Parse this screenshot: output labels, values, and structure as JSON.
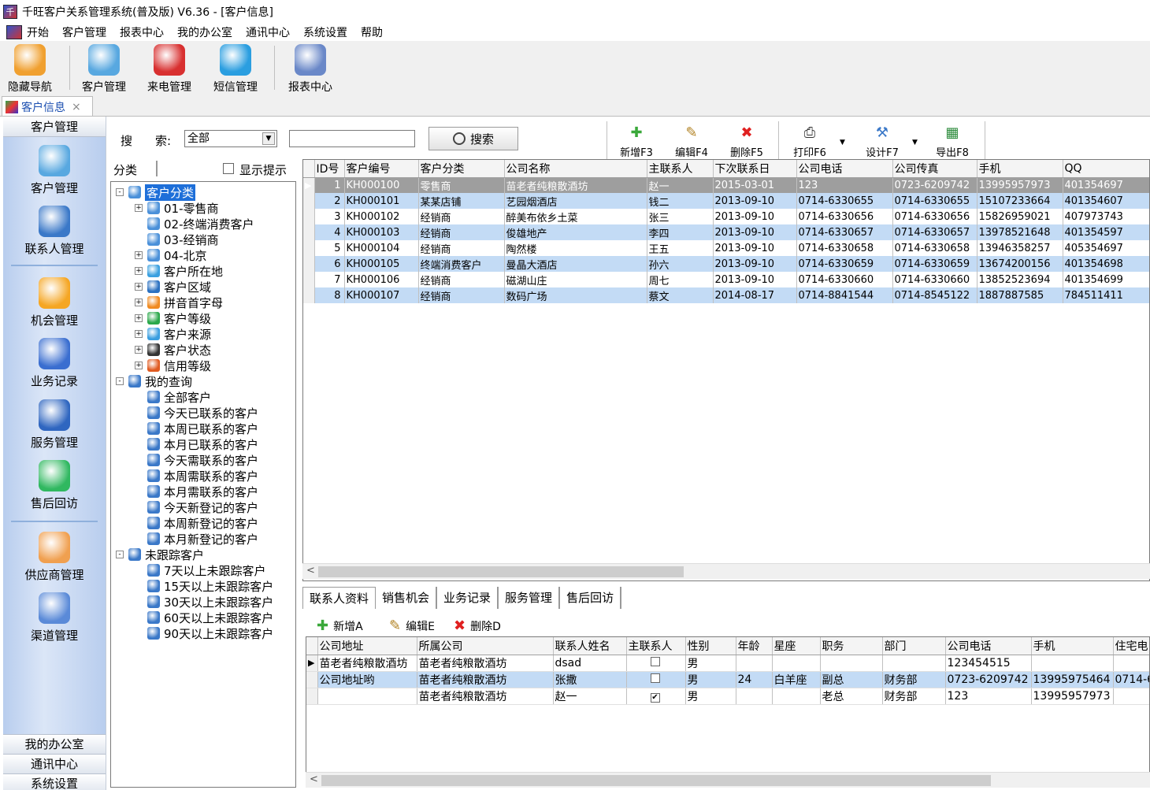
{
  "window": {
    "title": "千旺客户关系管理系统(普及版) V6.36 - [客户信息]"
  },
  "menu": [
    "开始",
    "客户管理",
    "报表中心",
    "我的办公室",
    "通讯中心",
    "系统设置",
    "帮助"
  ],
  "toolbar": {
    "items": [
      {
        "label": "隐藏导航",
        "icon": "butterfly-logo-icon",
        "color": "#f0a030"
      },
      {
        "label": "客户管理",
        "icon": "users-icon",
        "color": "#58a8e0"
      },
      {
        "label": "来电管理",
        "icon": "phone-icon",
        "color": "#d83030"
      },
      {
        "label": "短信管理",
        "icon": "message-icon",
        "color": "#2a9ee0"
      },
      {
        "label": "报表中心",
        "icon": "report-chart-icon",
        "color": "#6a88c8"
      }
    ]
  },
  "doc_tab": {
    "label": "客户信息",
    "close": "×"
  },
  "leftnav": {
    "header": "客户管理",
    "items": [
      {
        "label": "客户管理",
        "icon": "users-icon",
        "color": "#58a8e0"
      },
      {
        "label": "联系人管理",
        "icon": "contact-person-icon",
        "color": "#3a78c8"
      },
      {
        "label": "机会管理",
        "icon": "star-icon",
        "color": "#f5a623"
      },
      {
        "label": "业务记录",
        "icon": "business-chart-icon",
        "color": "#3a6ed0"
      },
      {
        "label": "服务管理",
        "icon": "globe-service-icon",
        "color": "#2f66c0"
      },
      {
        "label": "售后回访",
        "icon": "chat-bubble-icon",
        "color": "#30b860"
      },
      {
        "label": "供应商管理",
        "icon": "supplier-face-icon",
        "color": "#f0a050"
      },
      {
        "label": "渠道管理",
        "icon": "channel-plane-icon",
        "color": "#5a8ad8"
      }
    ],
    "footer": [
      "我的办公室",
      "通讯中心",
      "系统设置"
    ]
  },
  "search": {
    "label_1": "搜",
    "label_2": "索:",
    "field_value": "全部",
    "input_value": "",
    "button": "搜索"
  },
  "actions": [
    {
      "label": "新增F3",
      "icon": "plus-icon",
      "glyph": "✚",
      "color": "#3aa83a"
    },
    {
      "label": "编辑F4",
      "icon": "edit-icon",
      "glyph": "✎",
      "color": "#b08020"
    },
    {
      "label": "删除F5",
      "icon": "delete-icon",
      "glyph": "✖",
      "color": "#e02020"
    },
    {
      "label": "打印F6",
      "icon": "printer-icon",
      "glyph": "⎙",
      "color": "#333333"
    },
    {
      "label": "设计F7",
      "icon": "tools-icon",
      "glyph": "⚒",
      "color": "#3a78c8"
    },
    {
      "label": "导出F8",
      "icon": "excel-export-icon",
      "glyph": "▦",
      "color": "#2a8a3a"
    }
  ],
  "category": {
    "header": "分类",
    "show_tips": "显示提示",
    "tree": [
      {
        "label": "客户分类",
        "level": 0,
        "pm": "-",
        "icon": "folder-icon",
        "color": "#4a90d9",
        "selected": true
      },
      {
        "label": "01-零售商",
        "level": 1,
        "pm": "+",
        "icon": "folder-icon",
        "color": "#4a90d9"
      },
      {
        "label": "02-终端消费客户",
        "level": 1,
        "pm": "",
        "icon": "folder-icon",
        "color": "#4a90d9"
      },
      {
        "label": "03-经销商",
        "level": 1,
        "pm": "",
        "icon": "folder-icon",
        "color": "#4a90d9"
      },
      {
        "label": "04-北京",
        "level": 1,
        "pm": "+",
        "icon": "folder-icon",
        "color": "#4a90d9"
      },
      {
        "label": "客户所在地",
        "level": 1,
        "pm": "+",
        "icon": "globe-icon",
        "color": "#3aa0e0"
      },
      {
        "label": "客户区域",
        "level": 1,
        "pm": "+",
        "icon": "globe-icon",
        "color": "#2a70c0"
      },
      {
        "label": "拼音首字母",
        "level": 1,
        "pm": "+",
        "icon": "letter-a-icon",
        "color": "#f08a20"
      },
      {
        "label": "客户等级",
        "level": 1,
        "pm": "+",
        "icon": "share-icon",
        "color": "#2aa84a"
      },
      {
        "label": "客户来源",
        "level": 1,
        "pm": "+",
        "icon": "source-icon",
        "color": "#3a9ee0"
      },
      {
        "label": "客户状态",
        "level": 1,
        "pm": "+",
        "icon": "status-icon",
        "color": "#333333"
      },
      {
        "label": "信用等级",
        "level": 1,
        "pm": "+",
        "icon": "credit-icon",
        "color": "#e05a20"
      },
      {
        "label": "我的查询",
        "level": 0,
        "pm": "-",
        "icon": "query-phone-icon",
        "color": "#3a78c8"
      },
      {
        "label": "全部客户",
        "level": 1,
        "pm": "",
        "icon": "query-phone-icon",
        "color": "#3a78c8"
      },
      {
        "label": "今天已联系的客户",
        "level": 1,
        "pm": "",
        "icon": "query-phone-icon",
        "color": "#3a78c8"
      },
      {
        "label": "本周已联系的客户",
        "level": 1,
        "pm": "",
        "icon": "query-phone-icon",
        "color": "#3a78c8"
      },
      {
        "label": "本月已联系的客户",
        "level": 1,
        "pm": "",
        "icon": "query-phone-icon",
        "color": "#3a78c8"
      },
      {
        "label": "今天需联系的客户",
        "level": 1,
        "pm": "",
        "icon": "query-phone-icon",
        "color": "#3a78c8"
      },
      {
        "label": "本周需联系的客户",
        "level": 1,
        "pm": "",
        "icon": "query-phone-icon",
        "color": "#3a78c8"
      },
      {
        "label": "本月需联系的客户",
        "level": 1,
        "pm": "",
        "icon": "query-phone-icon",
        "color": "#3a78c8"
      },
      {
        "label": "今天新登记的客户",
        "level": 1,
        "pm": "",
        "icon": "query-phone-icon",
        "color": "#3a78c8"
      },
      {
        "label": "本周新登记的客户",
        "level": 1,
        "pm": "",
        "icon": "query-phone-icon",
        "color": "#3a78c8"
      },
      {
        "label": "本月新登记的客户",
        "level": 1,
        "pm": "",
        "icon": "query-phone-icon",
        "color": "#3a78c8"
      },
      {
        "label": "未跟踪客户",
        "level": 0,
        "pm": "-",
        "icon": "query-phone-icon",
        "color": "#3a78c8"
      },
      {
        "label": "7天以上未跟踪客户",
        "level": 1,
        "pm": "",
        "icon": "query-phone-icon",
        "color": "#3a78c8"
      },
      {
        "label": "15天以上未跟踪客户",
        "level": 1,
        "pm": "",
        "icon": "query-phone-icon",
        "color": "#3a78c8"
      },
      {
        "label": "30天以上未跟踪客户",
        "level": 1,
        "pm": "",
        "icon": "query-phone-icon",
        "color": "#3a78c8"
      },
      {
        "label": "60天以上未跟踪客户",
        "level": 1,
        "pm": "",
        "icon": "query-phone-icon",
        "color": "#3a78c8"
      },
      {
        "label": "90天以上未跟踪客户",
        "level": 1,
        "pm": "",
        "icon": "query-phone-icon",
        "color": "#3a78c8"
      }
    ]
  },
  "customers": {
    "columns": [
      "ID号",
      "客户编号",
      "客户分类",
      "公司名称",
      "主联系人",
      "下次联系日",
      "公司电话",
      "公司传真",
      "手机",
      "QQ"
    ],
    "rows": [
      [
        "1",
        "KH000100",
        "零售商",
        "苗老者纯粮散酒坊",
        "赵一",
        "2015-03-01",
        "123",
        "0723-6209742",
        "13995957973",
        "401354697"
      ],
      [
        "2",
        "KH000101",
        "某某店铺",
        "艺园烟酒店",
        "钱二",
        "2013-09-10",
        "0714-6330655",
        "0714-6330655",
        "15107233664",
        "401354607"
      ],
      [
        "3",
        "KH000102",
        "经销商",
        "醉美布依乡土菜",
        "张三",
        "2013-09-10",
        "0714-6330656",
        "0714-6330656",
        "15826959021",
        "407973743"
      ],
      [
        "4",
        "KH000103",
        "经销商",
        "俊雄地产",
        "李四",
        "2013-09-10",
        "0714-6330657",
        "0714-6330657",
        "13978521648",
        "401354597"
      ],
      [
        "5",
        "KH000104",
        "经销商",
        "陶然楼",
        "王五",
        "2013-09-10",
        "0714-6330658",
        "0714-6330658",
        "13946358257",
        "405354697"
      ],
      [
        "6",
        "KH000105",
        "终端消费客户",
        "曼晶大酒店",
        "孙六",
        "2013-09-10",
        "0714-6330659",
        "0714-6330659",
        "13674200156",
        "401354698"
      ],
      [
        "7",
        "KH000106",
        "经销商",
        "磁湖山庄",
        "周七",
        "2013-09-10",
        "0714-6330660",
        "0714-6330660",
        "13852523694",
        "401354699"
      ],
      [
        "8",
        "KH000107",
        "经销商",
        "数码广场",
        "蔡文",
        "2014-08-17",
        "0714-8841544",
        "0714-8545122",
        "1887887585",
        "784511411"
      ]
    ],
    "scroll_left": "<"
  },
  "detail_tabs": [
    "联系人资料",
    "销售机会",
    "业务记录",
    "服务管理",
    "售后回访"
  ],
  "detail_actions": [
    {
      "label": "新增A",
      "icon": "plus-icon",
      "glyph": "✚",
      "color": "#3aa83a"
    },
    {
      "label": "编辑E",
      "icon": "edit-icon",
      "glyph": "✎",
      "color": "#b08020"
    },
    {
      "label": "删除D",
      "icon": "delete-icon",
      "glyph": "✖",
      "color": "#e02020"
    }
  ],
  "contacts": {
    "columns": [
      "公司地址",
      "所属公司",
      "联系人姓名",
      "主联系人",
      "性别",
      "年龄",
      "星座",
      "职务",
      "部门",
      "公司电话",
      "手机",
      "住宅电"
    ],
    "rows": [
      [
        "苗老者纯粮散酒坊",
        "苗老者纯粮散酒坊",
        "dsad",
        "",
        "男",
        "",
        "",
        "",
        "",
        "123454515",
        "",
        ""
      ],
      [
        "公司地址哟",
        "苗老者纯粮散酒坊",
        "张撒",
        "",
        "男",
        "24",
        "白羊座",
        "副总",
        "财务部",
        "0723-6209742",
        "13995975464",
        "0714-6"
      ],
      [
        "",
        "苗老者纯粮散酒坊",
        "赵一",
        "✔",
        "男",
        "",
        "",
        "老总",
        "财务部",
        "123",
        "13995957973",
        ""
      ]
    ],
    "scroll_left": "<"
  }
}
